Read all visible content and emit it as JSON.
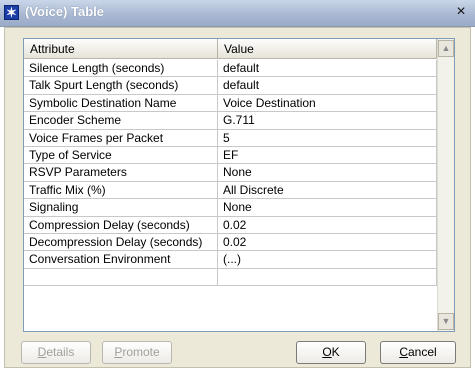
{
  "window": {
    "title": "(Voice) Table",
    "close_symbol": "×"
  },
  "table": {
    "columns": [
      "Attribute",
      "Value"
    ],
    "rows": [
      [
        "Silence Length (seconds)",
        "default"
      ],
      [
        "Talk Spurt Length (seconds)",
        "default"
      ],
      [
        "Symbolic Destination Name",
        "Voice Destination"
      ],
      [
        "Encoder Scheme",
        "G.711"
      ],
      [
        "Voice Frames per Packet",
        "5"
      ],
      [
        "Type of Service",
        "EF"
      ],
      [
        "RSVP Parameters",
        "None"
      ],
      [
        "Traffic Mix (%)",
        "All Discrete"
      ],
      [
        "Signaling",
        "None"
      ],
      [
        "Compression Delay (seconds)",
        "0.02"
      ],
      [
        "Decompression Delay (seconds)",
        "0.02"
      ],
      [
        "Conversation Environment",
        "(...)"
      ],
      [
        "",
        ""
      ]
    ]
  },
  "buttons": {
    "details": {
      "label": "Details",
      "mnemonic": "D",
      "rest": "etails"
    },
    "promote": {
      "label": "Promote",
      "mnemonic": "P",
      "rest": "romote"
    },
    "ok": {
      "label": "OK",
      "mnemonic": "O",
      "rest": "K"
    },
    "cancel": {
      "label": "Cancel",
      "mnemonic": "C",
      "rest": "ancel"
    }
  },
  "icons": {
    "app": "star-icon",
    "scroll_up": "arrow-up-icon",
    "scroll_down": "arrow-down-icon"
  }
}
